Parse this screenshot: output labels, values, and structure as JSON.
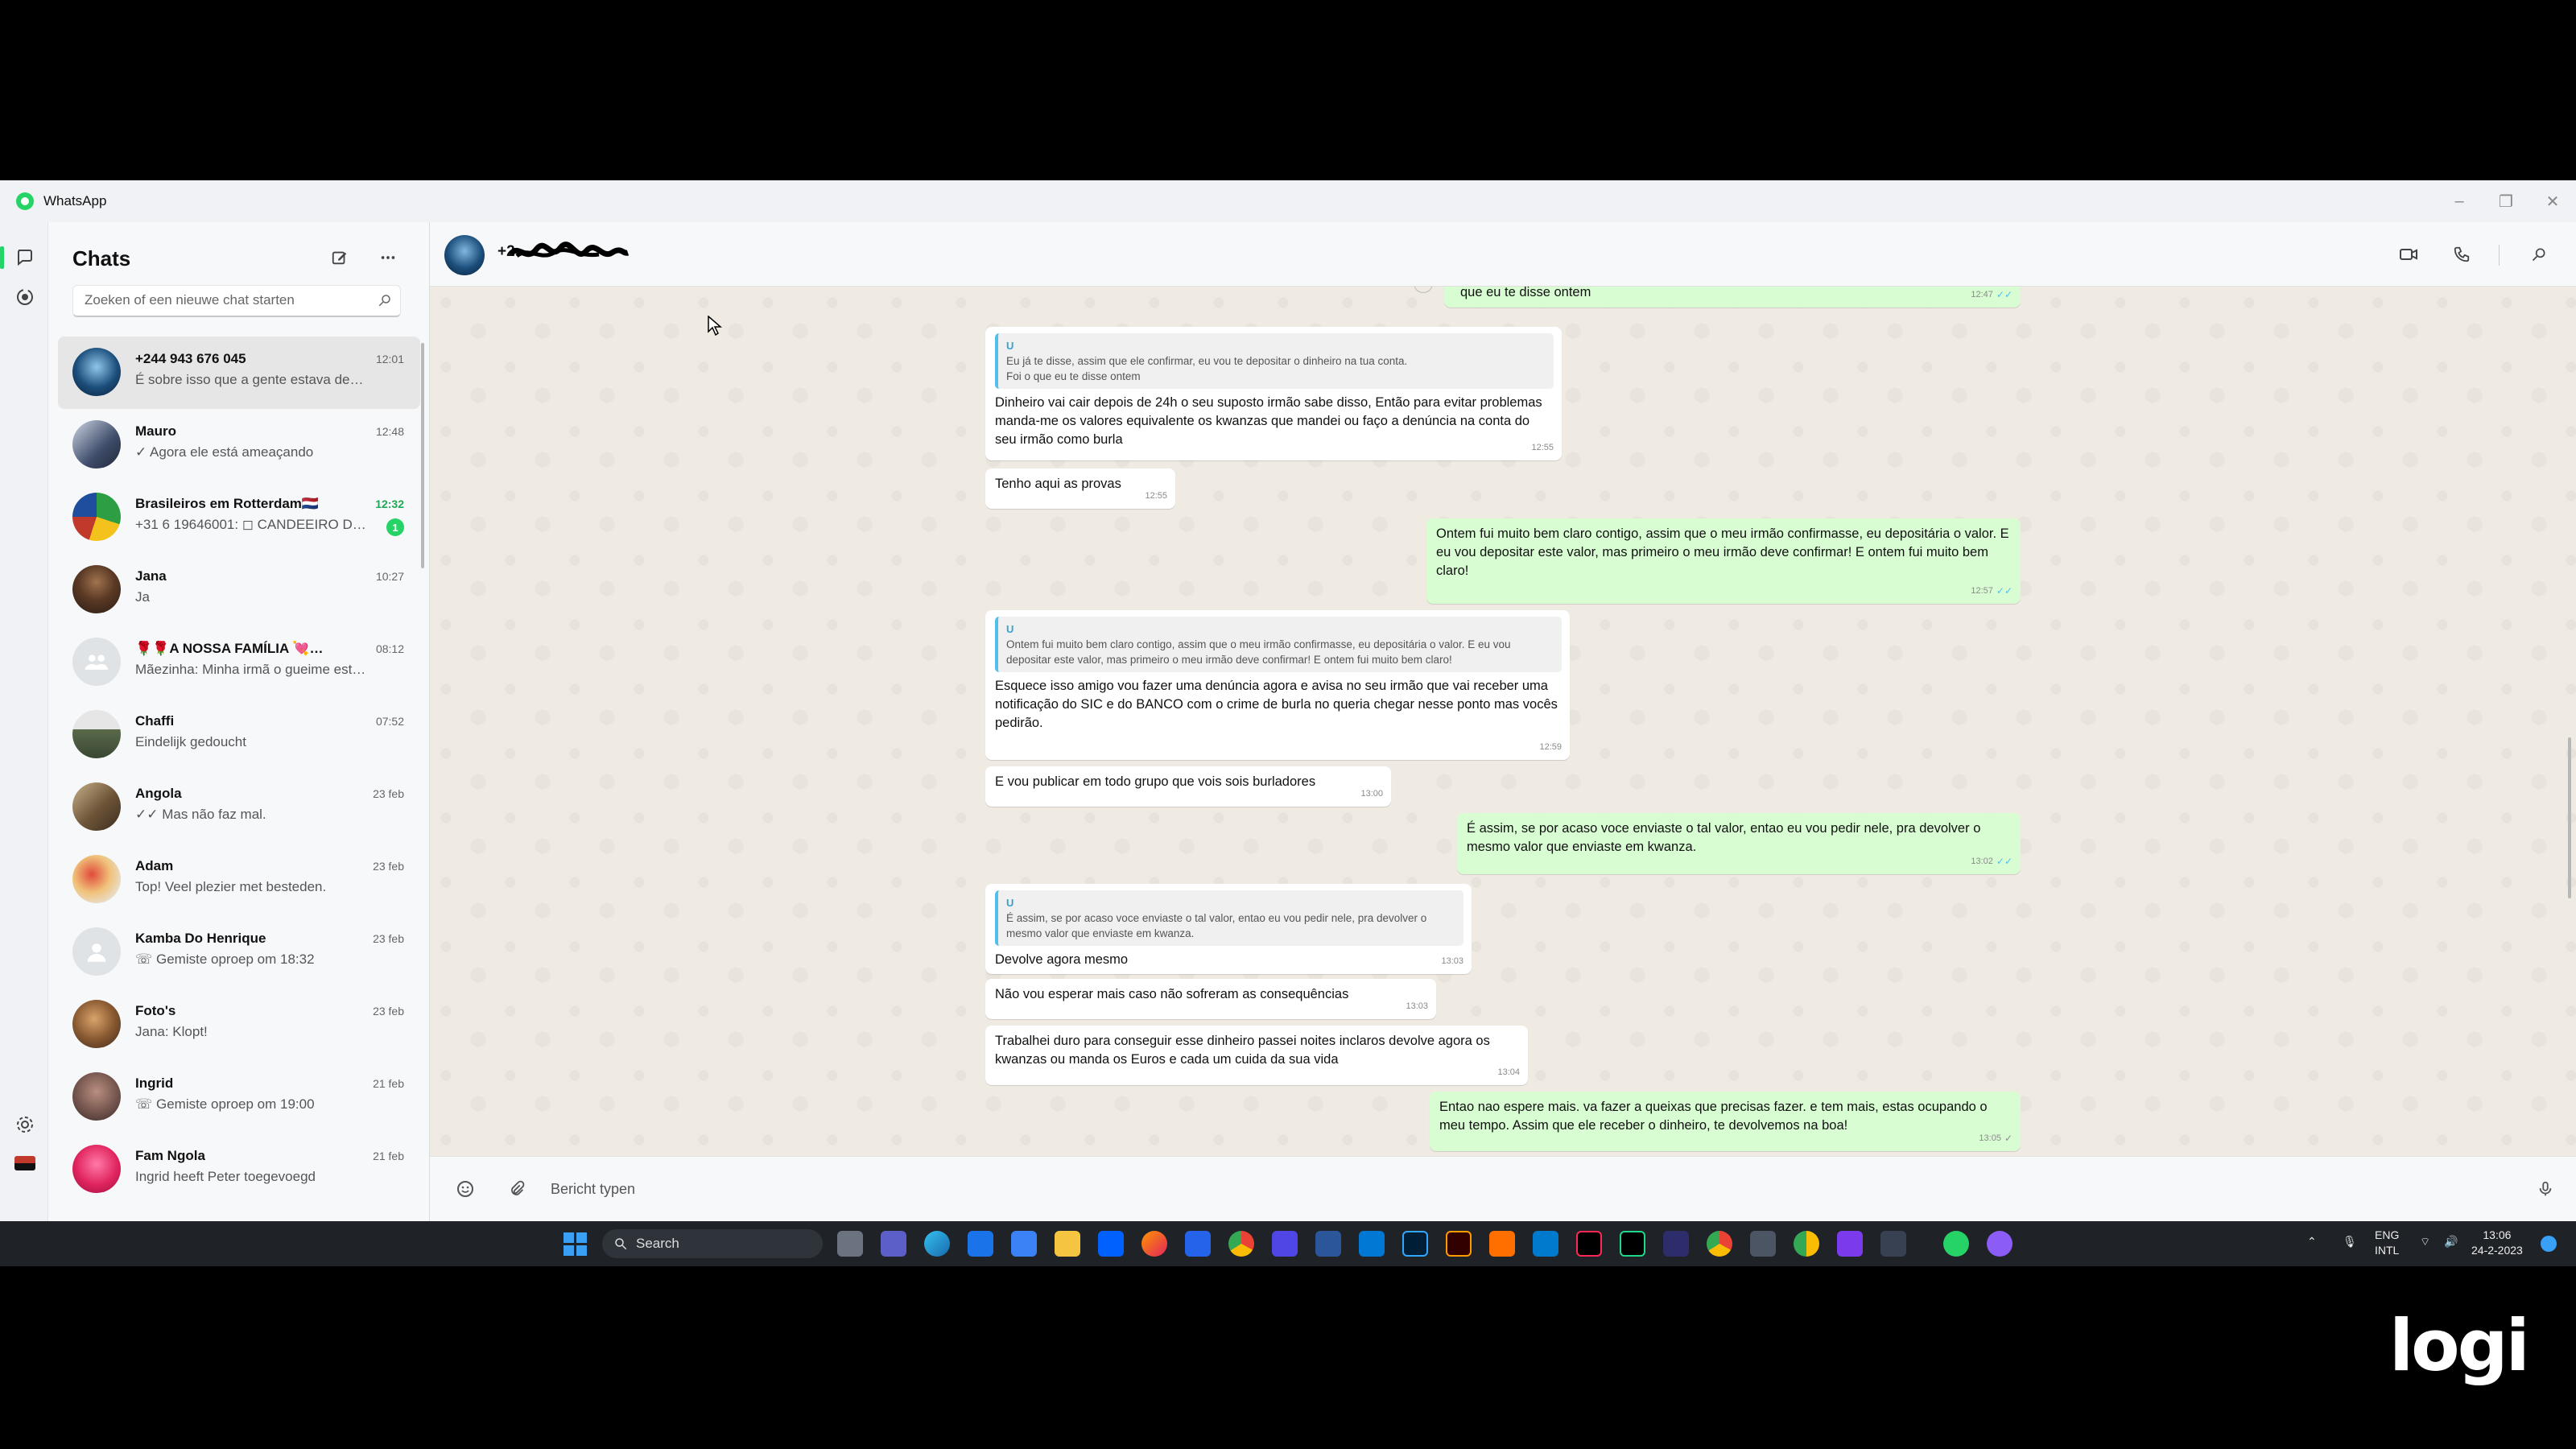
{
  "window": {
    "title": "WhatsApp"
  },
  "sidebar": {
    "title": "Chats",
    "search_placeholder": "Zoeken of een nieuwe chat starten",
    "chats": [
      {
        "name": "+244 943 676 045",
        "preview": "É sobre isso que a gente estava descoti...",
        "time": "12:01",
        "active": true
      },
      {
        "name": "Mauro",
        "preview": "✓ Agora ele  está ameaçando",
        "time": "12:48"
      },
      {
        "name": "Brasileiros em Rotterdam🇳🇱",
        "preview": "+31 6 19646001: ◻ CANDEEIRO DE...",
        "time": "12:32",
        "unread": "1"
      },
      {
        "name": "Jana",
        "preview": "Ja",
        "time": "10:27"
      },
      {
        "name": "🌹🌹A NOSSA FAMÍLIA 💘💓😘",
        "preview": "Mãezinha: Minha irmã o gueime está vi...",
        "time": "08:12"
      },
      {
        "name": "Chaffi",
        "preview": "Eindelijk gedoucht",
        "time": "07:52"
      },
      {
        "name": "Angola",
        "preview": "✓✓ Mas não faz mal.",
        "time": "23 feb"
      },
      {
        "name": "Adam",
        "preview": "Top! Veel plezier met besteden.",
        "time": "23 feb"
      },
      {
        "name": "Kamba Do Henrique",
        "preview": "☏ Gemiste oproep om 18:32",
        "time": "23 feb"
      },
      {
        "name": "Foto's",
        "preview": "Jana: Klopt!",
        "time": "23 feb"
      },
      {
        "name": "Ingrid",
        "preview": "☏ Gemiste oproep om 19:00",
        "time": "21 feb"
      },
      {
        "name": "Fam Ngola",
        "preview": "Ingrid heeft Peter toegevoegd",
        "time": "21 feb"
      }
    ]
  },
  "conversation": {
    "contact_name": "+2",
    "messages": [
      {
        "dir": "out",
        "text": "que eu te disse ontem",
        "time": "12:47",
        "tick": "read"
      },
      {
        "dir": "in",
        "quote_author": "U",
        "quote": "Eu já te disse, assim que ele confirmar, eu vou te depositar o dinheiro na tua conta.\nFoi o que eu te disse ontem",
        "text": "Dinheiro vai cair depois de 24h o seu suposto irmão sabe disso, Então para evitar problemas manda-me os valores equivalente os kwanzas que mandei ou faço a denúncia na conta do seu irmão como burla",
        "time": "12:55"
      },
      {
        "dir": "in",
        "text": "Tenho aqui as provas",
        "time": "12:55"
      },
      {
        "dir": "out",
        "text": "Ontem fui muito bem claro contigo, assim que o meu irmão confirmasse, eu depositária o valor. E eu vou depositar este valor, mas primeiro o meu irmão deve confirmar! E ontem fui muito bem claro!",
        "time": "12:57",
        "tick": "read"
      },
      {
        "dir": "in",
        "quote_author": "U",
        "quote": "Ontem fui muito bem claro contigo, assim que o meu irmão confirmasse, eu depositária o valor. E eu vou depositar este valor, mas primeiro o meu irmão deve confirmar! E ontem fui muito bem claro!",
        "text": "Esquece isso amigo vou fazer uma denúncia agora e avisa no seu irmão que vai receber uma notificação do SIC e do BANCO com o crime de burla no queria chegar nesse ponto mas vocês pedirão.",
        "time": "12:59"
      },
      {
        "dir": "in",
        "text": "E vou publicar em todo grupo que vois sois burladores",
        "time": "13:00"
      },
      {
        "dir": "out",
        "text": "É assim, se por acaso voce enviaste o tal valor, entao eu vou pedir nele, pra devolver o mesmo valor que enviaste em kwanza.",
        "time": "13:02",
        "tick": "read"
      },
      {
        "dir": "in",
        "quote_author": "U",
        "quote": "É assim, se por acaso voce enviaste o tal valor, entao eu vou pedir nele, pra devolver o mesmo valor que enviaste em kwanza.",
        "text": "Devolve agora mesmo",
        "time": "13:03"
      },
      {
        "dir": "in",
        "text": "Não vou esperar mais caso não sofreram as consequências",
        "time": "13:03"
      },
      {
        "dir": "in",
        "text": "Trabalhei duro para conseguir esse dinheiro passei noites inclaros devolve agora os kwanzas ou manda os Euros e cada um cuida da sua vida",
        "time": "13:04"
      },
      {
        "dir": "out",
        "text": "Entao nao espere mais. va fazer a queixas que precisas fazer. e tem mais, estas ocupando o meu tempo. Assim que ele receber o dinheiro, te devolvemos na boa!",
        "time": "13:05",
        "tick": "sent"
      }
    ],
    "composer_placeholder": "Bericht typen"
  },
  "taskbar": {
    "search_label": "Search",
    "lang_line1": "ENG",
    "lang_line2": "INTL",
    "clock_time": "13:06",
    "clock_date": "24-2-2023"
  },
  "watermark": "logi",
  "colors": {
    "accent": "#25d366",
    "outgoing": "#d9fdd3",
    "read_tick": "#53bdeb"
  }
}
